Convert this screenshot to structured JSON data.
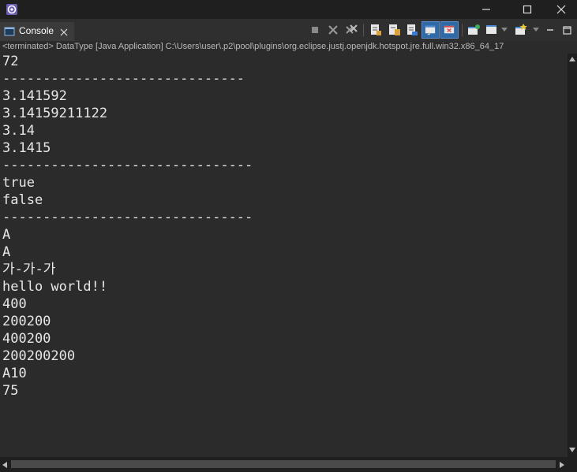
{
  "window": {
    "minimize_glyph": "—",
    "maximize_glyph": "☐",
    "close_glyph": "✕"
  },
  "tab": {
    "label": "Console",
    "close_glyph": "✕"
  },
  "status": {
    "text": "<terminated> DataType [Java Application] C:\\Users\\user\\.p2\\pool\\plugins\\org.eclipse.justj.openjdk.hotspot.jre.full.win32.x86_64_17"
  },
  "output": {
    "lines": [
      "72",
      "------------------------------",
      "3.141592",
      "3.14159211122",
      "3.14",
      "3.1415",
      "-------------------------------",
      "true",
      "false",
      "-------------------------------",
      "A",
      "A",
      "가-가-가",
      "hello world!!",
      "400",
      "200200",
      "400200",
      "200200200",
      "A10",
      "75"
    ]
  },
  "colors": {
    "background": "#2b2b2b",
    "text": "#e6e6e6",
    "accent": "#2f6aa6"
  }
}
